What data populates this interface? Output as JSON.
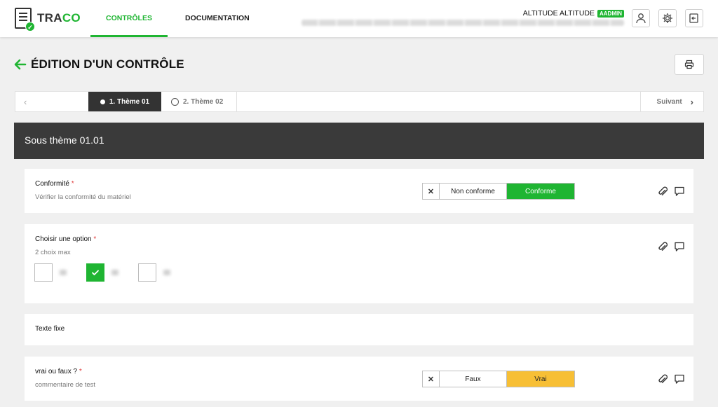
{
  "app": {
    "logo_prefix": "TRA",
    "logo_suffix": "CO"
  },
  "nav": {
    "items": [
      {
        "label": "CONTRÔLES",
        "active": true
      },
      {
        "label": "DOCUMENTATION",
        "active": false
      }
    ]
  },
  "user": {
    "name": "ALTITUDE ALTITUDE",
    "role_badge": "AADMIN"
  },
  "page": {
    "title": "ÉDITION D'UN CONTRÔLE"
  },
  "themes": {
    "tabs": [
      {
        "label": "1. Thème 01",
        "active": true
      },
      {
        "label": "2. Thème 02",
        "active": false
      }
    ],
    "next_label": "Suivant"
  },
  "subtheme": {
    "title": "Sous thème 01.01"
  },
  "questions": [
    {
      "label": "Conformité",
      "required": "*",
      "subtext": "Vérifier la conformité du matériel",
      "options": [
        "Non conforme",
        "Conforme"
      ],
      "selected": "Conforme"
    },
    {
      "label": "Choisir une option",
      "required": "*",
      "subtext": "2 choix max",
      "checkbox_states": [
        false,
        true,
        false
      ]
    },
    {
      "label": "Texte fixe"
    },
    {
      "label": "vrai ou faux ?",
      "required": "*",
      "subtext": "commentaire de test",
      "options": [
        "Faux",
        "Vrai"
      ],
      "selected": "Vrai"
    }
  ],
  "colors": {
    "accent": "#1fb532",
    "dark": "#3a3a3a",
    "selected_yellow": "#f7bf35",
    "required": "#e03a3a"
  }
}
